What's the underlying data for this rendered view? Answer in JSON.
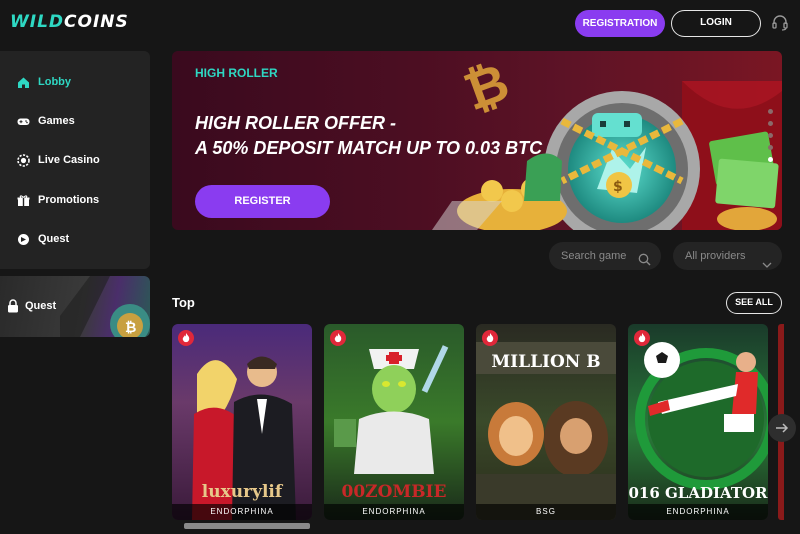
{
  "brand": {
    "logo_part1": "WILD",
    "logo_part2": "COINS"
  },
  "header": {
    "registration_label": "REGISTRATION",
    "login_label": "LOGIN",
    "support_icon": "headset-icon"
  },
  "sidebar": {
    "items": [
      {
        "label": "Lobby",
        "icon": "home-icon",
        "active": true
      },
      {
        "label": "Games",
        "icon": "gamepad-icon"
      },
      {
        "label": "Live Casino",
        "icon": "chip-icon"
      },
      {
        "label": "Promotions",
        "icon": "gift-icon"
      },
      {
        "label": "Quest",
        "icon": "quest-icon"
      }
    ],
    "quest_card_label": "Quest"
  },
  "banner": {
    "tag": "HIGH ROLLER",
    "title_line1": "HIGH ROLLER OFFER -",
    "title_line2": "A 50% DEPOSIT MATCH UP TO 0.03 BTC",
    "cta_label": "REGISTER",
    "slides_total": 5,
    "active_slide": 5
  },
  "filters": {
    "search_placeholder": "Search game",
    "providers_value": "All providers"
  },
  "section": {
    "title": "Top",
    "see_all_label": "SEE ALL"
  },
  "games": [
    {
      "name": "luxurylif",
      "provider": "ENDORPHINA"
    },
    {
      "name": "00ZOMBIE",
      "provider": "ENDORPHINA"
    },
    {
      "name": "MILLION B",
      "provider": "BSG"
    },
    {
      "name": "016 GLADIATOR",
      "provider": "ENDORPHINA"
    }
  ],
  "colors": {
    "accent_teal": "#2ed8c3",
    "accent_purple": "#8a3cf0",
    "hot_badge": "#e0283a",
    "background": "#161616"
  }
}
